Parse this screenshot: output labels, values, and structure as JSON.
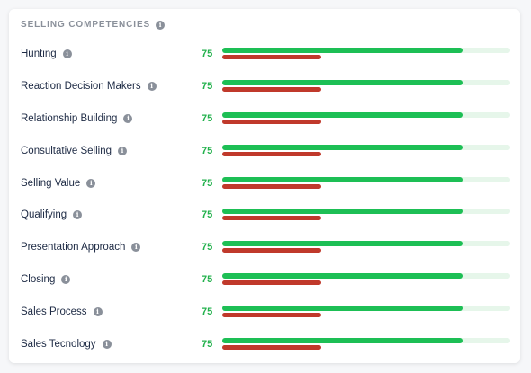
{
  "header": {
    "title": "SELLING COMPETENCIES",
    "info_icon": "info-icon"
  },
  "colors": {
    "score": "#22b14c",
    "bar_fill": "#1dbf55",
    "bar_track": "#e6f6ea",
    "benchmark": "#c0392b"
  },
  "competencies": [
    {
      "label": "Hunting",
      "score": "75",
      "fill": 0.835,
      "benchmark": 0.345
    },
    {
      "label": "Reaction Decision Makers",
      "score": "75",
      "fill": 0.835,
      "benchmark": 0.345
    },
    {
      "label": "Relationship Building",
      "score": "75",
      "fill": 0.835,
      "benchmark": 0.345
    },
    {
      "label": "Consultative Selling",
      "score": "75",
      "fill": 0.835,
      "benchmark": 0.345
    },
    {
      "label": "Selling Value",
      "score": "75",
      "fill": 0.835,
      "benchmark": 0.345
    },
    {
      "label": "Qualifying",
      "score": "75",
      "fill": 0.835,
      "benchmark": 0.345
    },
    {
      "label": "Presentation Approach",
      "score": "75",
      "fill": 0.835,
      "benchmark": 0.345
    },
    {
      "label": "Closing",
      "score": "75",
      "fill": 0.835,
      "benchmark": 0.345
    },
    {
      "label": "Sales Process",
      "score": "75",
      "fill": 0.835,
      "benchmark": 0.345
    },
    {
      "label": "Sales Tecnology",
      "score": "75",
      "fill": 0.835,
      "benchmark": 0.345
    }
  ]
}
